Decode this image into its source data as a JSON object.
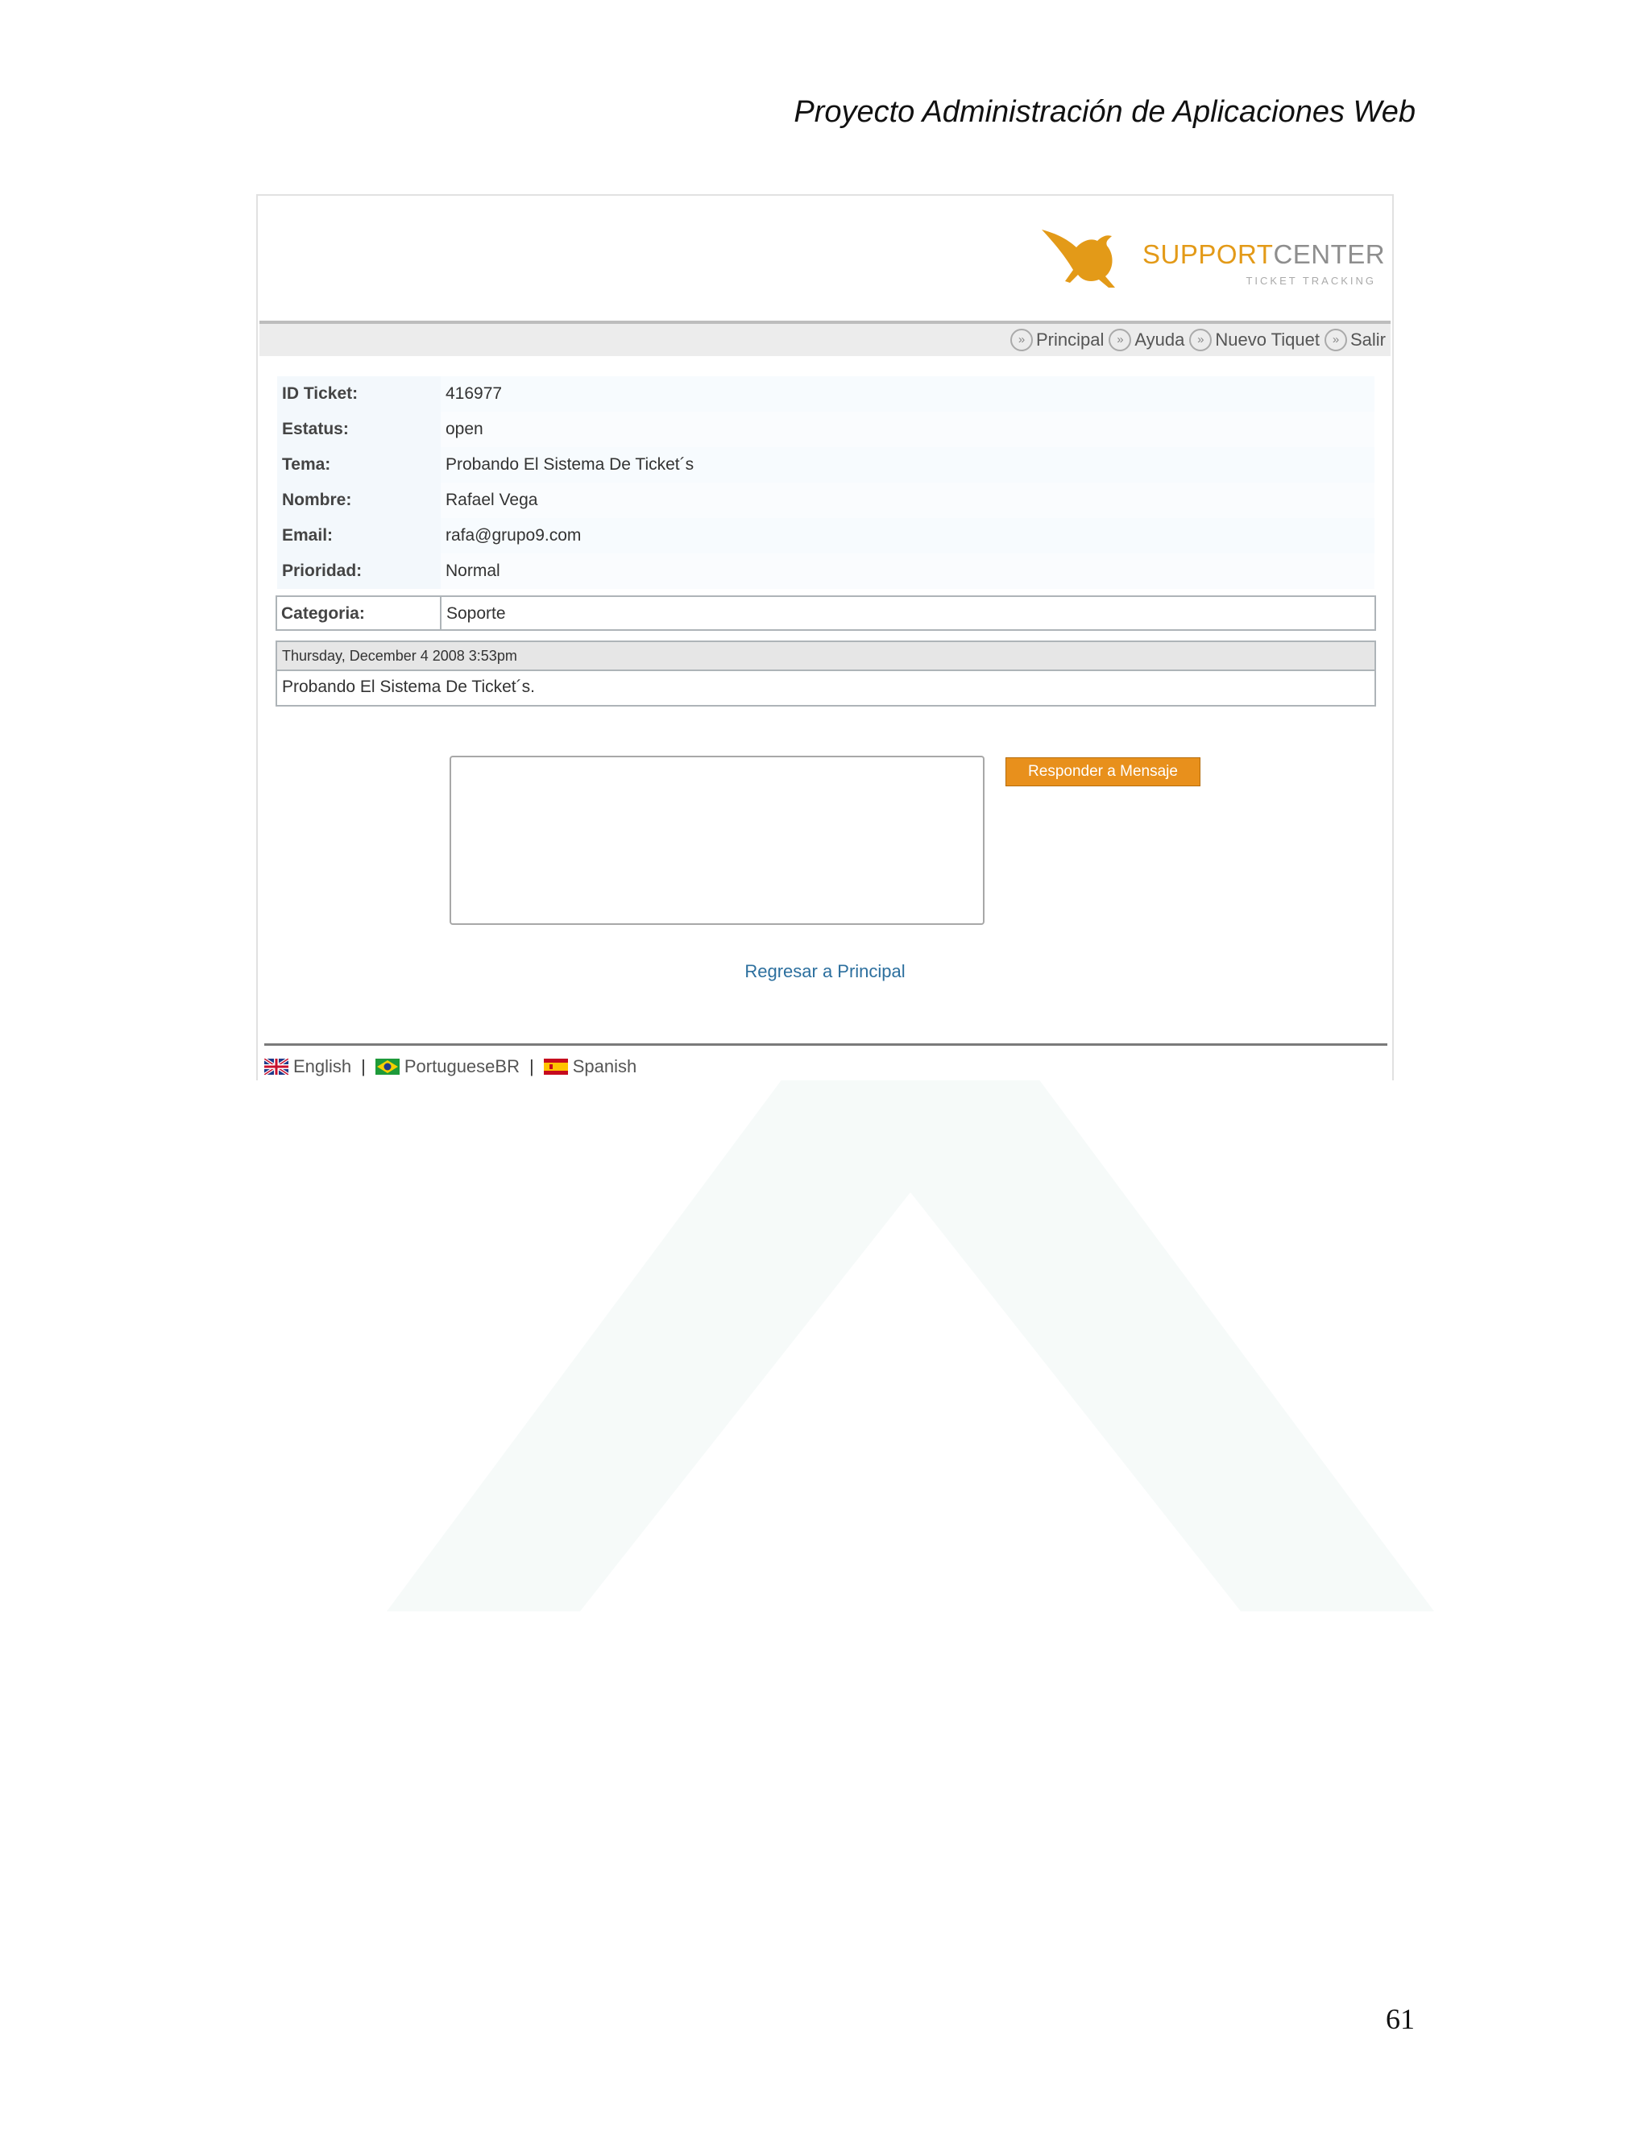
{
  "document": {
    "header_title": "Proyecto Administración de Aplicaciones Web",
    "page_number": "61"
  },
  "app": {
    "logo": {
      "brand_primary": "SUPPORT",
      "brand_secondary": "CENTER",
      "tagline": "TICKET TRACKING",
      "accent_color": "#e39a18"
    },
    "nav": [
      {
        "label": "Principal",
        "icon": "double-chevron-right-icon"
      },
      {
        "label": "Ayuda",
        "icon": "double-chevron-right-icon"
      },
      {
        "label": "Nuevo Tiquet",
        "icon": "double-chevron-right-icon"
      },
      {
        "label": "Salir",
        "icon": "double-chevron-right-icon"
      }
    ],
    "ticket": {
      "fields": [
        {
          "label": "ID Ticket:",
          "value": "416977"
        },
        {
          "label": "Estatus:",
          "value": "open"
        },
        {
          "label": "Tema:",
          "value": "Probando El Sistema De Ticket´s"
        },
        {
          "label": "Nombre:",
          "value": "Rafael Vega"
        },
        {
          "label": "Email:",
          "value": "rafa@grupo9.com"
        },
        {
          "label": "Prioridad:",
          "value": "Normal"
        }
      ],
      "category": {
        "label": "Categoria:",
        "value": "Soporte"
      },
      "message": {
        "date": "Thursday, December 4 2008 3:53pm",
        "text": "Probando El Sistema De Ticket´s."
      }
    },
    "reply": {
      "textarea_value": "",
      "button_label": "Responder a Mensaje",
      "button_color": "#e8901c"
    },
    "back_link": "Regresar a Principal",
    "languages": [
      {
        "label": "English",
        "icon": "uk-flag-icon"
      },
      {
        "label": "PortugueseBR",
        "icon": "brazil-flag-icon"
      },
      {
        "label": "Spanish",
        "icon": "spain-flag-icon"
      }
    ],
    "language_separator": "|"
  }
}
